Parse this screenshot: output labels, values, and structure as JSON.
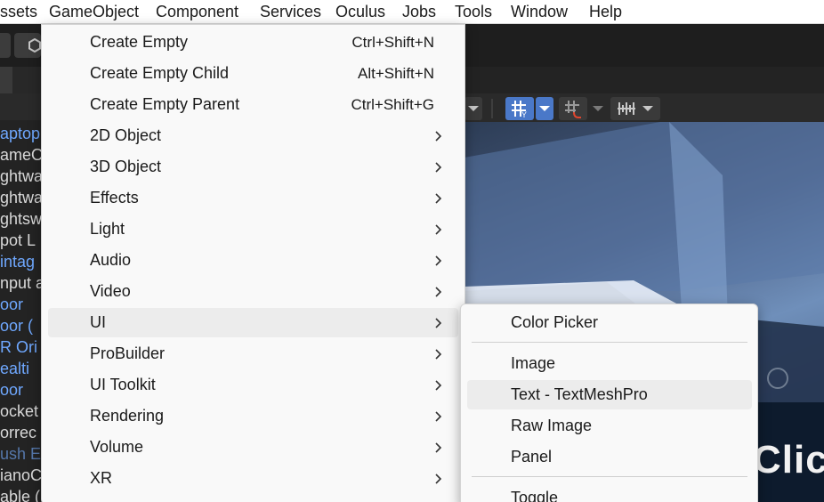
{
  "menubar": {
    "items": [
      "ssets",
      "GameObject",
      "Component",
      "Services",
      "Oculus",
      "Jobs",
      "Tools",
      "Window",
      "Help"
    ]
  },
  "hierarchy": {
    "rows": [
      {
        "text": "aptop",
        "color": "#6fa8ff"
      },
      {
        "text": "ameO",
        "color": "#d8d8d8"
      },
      {
        "text": "ghtwa",
        "color": "#d8d8d8"
      },
      {
        "text": "ghtwa",
        "color": "#d8d8d8"
      },
      {
        "text": "ghtsw",
        "color": "#d8d8d8"
      },
      {
        "text": "pot L",
        "color": "#d8d8d8"
      },
      {
        "text": "intag",
        "color": "#6fa8ff"
      },
      {
        "text": "nput a",
        "color": "#d8d8d8"
      },
      {
        "text": "oor",
        "color": "#6fa8ff"
      },
      {
        "text": "oor (",
        "color": "#6fa8ff"
      },
      {
        "text": "R Ori",
        "color": "#6fa8ff"
      },
      {
        "text": "ealti",
        "color": "#6fa8ff"
      },
      {
        "text": "oor",
        "color": "#6fa8ff"
      },
      {
        "text": "ocket",
        "color": "#d8d8d8"
      },
      {
        "text": "orrec",
        "color": "#d8d8d8"
      },
      {
        "text": "ush E",
        "color": "#5577aa"
      },
      {
        "text": "ianoC",
        "color": "#d8d8d8"
      },
      {
        "text": "able (",
        "color": "#d8d8d8"
      }
    ]
  },
  "gameobject_menu": {
    "items": [
      {
        "label": "Create Empty",
        "shortcut": "Ctrl+Shift+N",
        "submenu": false
      },
      {
        "label": "Create Empty Child",
        "shortcut": "Alt+Shift+N",
        "submenu": false
      },
      {
        "label": "Create Empty Parent",
        "shortcut": "Ctrl+Shift+G",
        "submenu": false
      },
      {
        "label": "2D Object",
        "shortcut": "",
        "submenu": true
      },
      {
        "label": "3D Object",
        "shortcut": "",
        "submenu": true
      },
      {
        "label": "Effects",
        "shortcut": "",
        "submenu": true
      },
      {
        "label": "Light",
        "shortcut": "",
        "submenu": true
      },
      {
        "label": "Audio",
        "shortcut": "",
        "submenu": true
      },
      {
        "label": "Video",
        "shortcut": "",
        "submenu": true
      },
      {
        "label": "UI",
        "shortcut": "",
        "submenu": true,
        "highlighted": true
      },
      {
        "label": "ProBuilder",
        "shortcut": "",
        "submenu": true
      },
      {
        "label": "UI Toolkit",
        "shortcut": "",
        "submenu": true
      },
      {
        "label": "Rendering",
        "shortcut": "",
        "submenu": true
      },
      {
        "label": "Volume",
        "shortcut": "",
        "submenu": true
      },
      {
        "label": "XR",
        "shortcut": "",
        "submenu": true
      }
    ]
  },
  "ui_submenu": {
    "items": [
      "Color Picker",
      "Image",
      "Text - TextMeshPro",
      "Raw Image",
      "Panel",
      "Toggle"
    ],
    "highlighted": "Text - TextMeshPro"
  },
  "scene": {
    "overlay_text": "Clic"
  },
  "colors": {
    "menu_bg": "#f9f9f9",
    "menu_highlight": "#ececec",
    "accent_blue": "#4a78c8",
    "hierarchy_link": "#6fa8ff"
  }
}
